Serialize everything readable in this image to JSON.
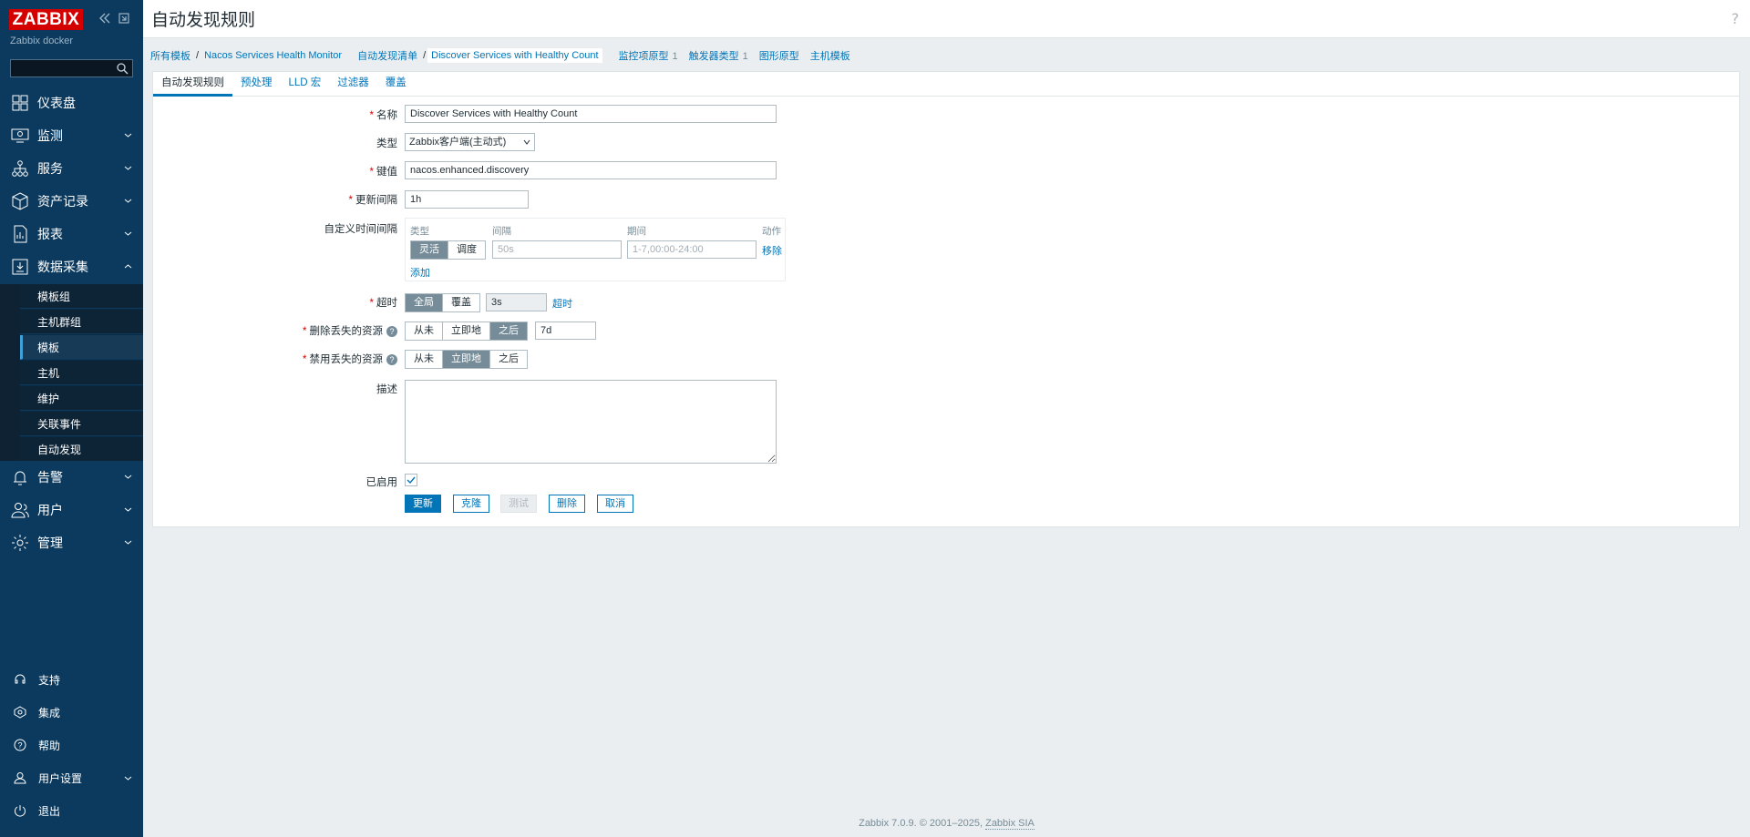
{
  "brand": {
    "logo": "ZABBIX",
    "server_name": "Zabbix docker"
  },
  "sidebar": {
    "search_placeholder": "",
    "menu": [
      {
        "label": "仪表盘",
        "icon": "dashboard-icon"
      },
      {
        "label": "监测",
        "icon": "monitoring-icon"
      },
      {
        "label": "服务",
        "icon": "services-icon"
      },
      {
        "label": "资产记录",
        "icon": "inventory-icon"
      },
      {
        "label": "报表",
        "icon": "reports-icon"
      },
      {
        "label": "数据采集",
        "icon": "data-collection-icon"
      },
      {
        "label": "告警",
        "icon": "alerts-icon"
      },
      {
        "label": "用户",
        "icon": "users-icon"
      },
      {
        "label": "管理",
        "icon": "administration-icon"
      }
    ],
    "submenu": [
      "模板组",
      "主机群组",
      "模板",
      "主机",
      "维护",
      "关联事件",
      "自动发现"
    ],
    "submenu_active": "模板",
    "bottom": [
      {
        "label": "支持",
        "icon": "support-icon"
      },
      {
        "label": "集成",
        "icon": "integrations-icon"
      },
      {
        "label": "帮助",
        "icon": "help-icon"
      },
      {
        "label": "用户设置",
        "icon": "user-settings-icon"
      },
      {
        "label": "退出",
        "icon": "signout-icon"
      }
    ]
  },
  "header": {
    "title": "自动发现规则",
    "help": "?"
  },
  "breadcrumb": {
    "all_templates": "所有模板",
    "template": "Nacos Services Health Monitor",
    "discovery_list": "自动发现清单",
    "current": "Discover Services with Healthy Count",
    "item_prototypes": "监控项原型",
    "item_prototypes_count": "1",
    "trigger_prototypes": "触发器类型",
    "trigger_prototypes_count": "1",
    "graph_prototypes": "图形原型",
    "host_prototypes": "主机模板"
  },
  "tabs": [
    "自动发现规则",
    "预处理",
    "LLD 宏",
    "过滤器",
    "覆盖"
  ],
  "form": {
    "name_label": "名称",
    "name_value": "Discover Services with Healthy Count",
    "type_label": "类型",
    "type_value": "Zabbix客户端(主动式)",
    "key_label": "键值",
    "key_value": "nacos.enhanced.discovery",
    "interval_label": "更新间隔",
    "interval_value": "1h",
    "custom_label": "自定义时间间隔",
    "custom_cols": {
      "type": "类型",
      "interval": "间隔",
      "period": "期间",
      "action": "动作"
    },
    "custom_flex": "灵活",
    "custom_sched": "调度",
    "custom_interval_placeholder": "50s",
    "custom_period_placeholder": "1-7,00:00-24:00",
    "custom_remove": "移除",
    "custom_add": "添加",
    "timeout_label": "超时",
    "timeout_global": "全局",
    "timeout_override": "覆盖",
    "timeout_value": "3s",
    "timeout_link": "超时",
    "delete_lost_label": "删除丢失的资源",
    "delete_opts": [
      "从未",
      "立即地",
      "之后"
    ],
    "delete_value": "7d",
    "disable_lost_label": "禁用丢失的资源",
    "disable_opts": [
      "从未",
      "立即地",
      "之后"
    ],
    "description_label": "描述",
    "enabled_label": "已启用"
  },
  "buttons": {
    "update": "更新",
    "clone": "克隆",
    "test": "测试",
    "delete": "删除",
    "cancel": "取消"
  },
  "footer": {
    "text": "Zabbix 7.0.9. © 2001–2025,",
    "company": "Zabbix SIA"
  },
  "colors": {
    "sidebar": "#0b3a5e",
    "accent": "#0275b8",
    "logo": "#d40000",
    "required": "#d40000"
  }
}
